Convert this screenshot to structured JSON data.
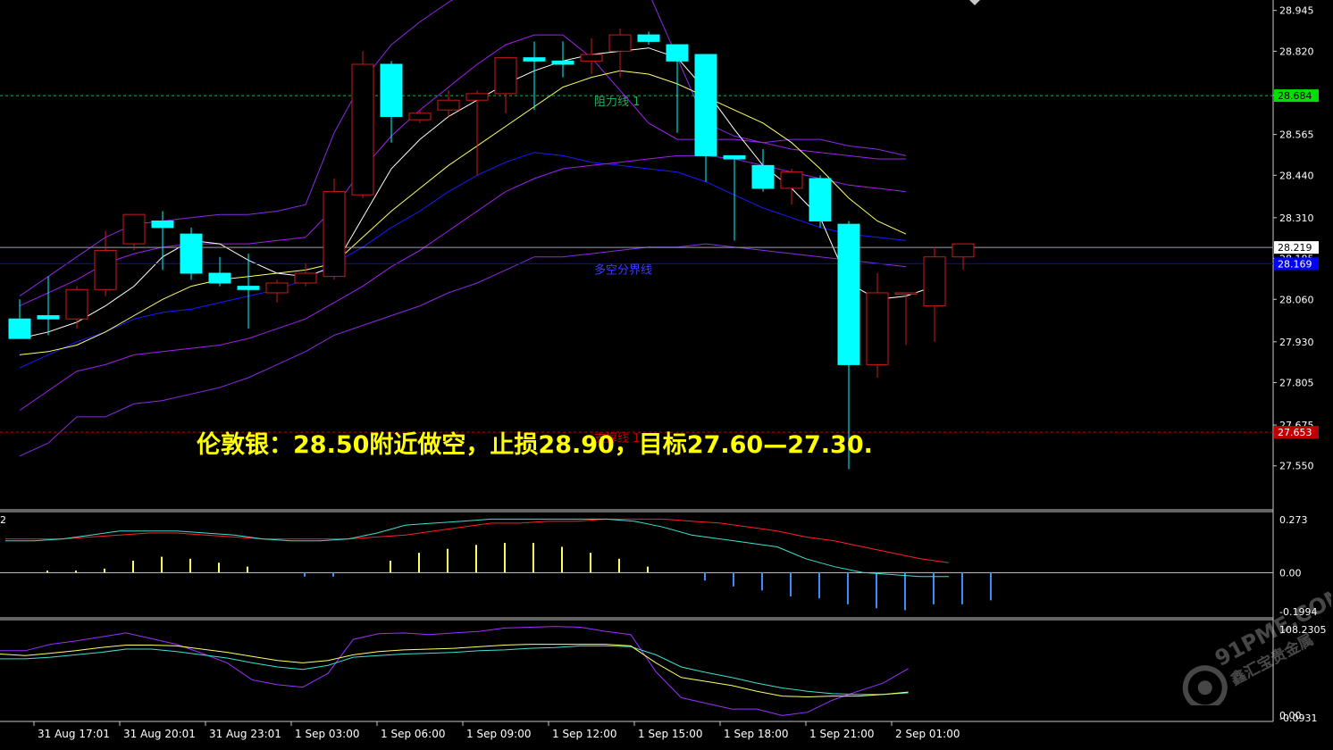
{
  "chart_data": {
    "type": "candlestick",
    "title": "",
    "price_ticks": [
      "28.945",
      "28.820",
      "28.685",
      "28.565",
      "28.440",
      "28.310",
      "28.185",
      "28.060",
      "27.930",
      "27.805",
      "27.675",
      "27.550"
    ],
    "price_range": [
      27.47,
      28.955
    ],
    "time_labels": [
      "31 Aug 17:01",
      "31 Aug 20:01",
      "31 Aug 23:01",
      "1 Sep 03:00",
      "1 Sep 06:00",
      "1 Sep 09:00",
      "1 Sep 12:00",
      "1 Sep 15:00",
      "1 Sep 18:00",
      "1 Sep 21:00",
      "2 Sep 01:00"
    ],
    "time_label_bars": [
      1,
      4,
      7,
      10,
      13,
      16,
      19,
      22,
      25,
      28,
      31
    ],
    "bar_spacing_bars": 32,
    "candles": [
      {
        "o": 28.0,
        "h": 28.06,
        "l": 27.95,
        "c": 27.94
      },
      {
        "o": 28.01,
        "h": 28.13,
        "l": 27.95,
        "c": 28.0
      },
      {
        "o": 28.0,
        "h": 28.1,
        "l": 27.97,
        "c": 28.09
      },
      {
        "o": 28.09,
        "h": 28.27,
        "l": 28.07,
        "c": 28.21
      },
      {
        "o": 28.23,
        "h": 28.32,
        "l": 28.21,
        "c": 28.32
      },
      {
        "o": 28.3,
        "h": 28.33,
        "l": 28.15,
        "c": 28.28
      },
      {
        "o": 28.26,
        "h": 28.28,
        "l": 28.12,
        "c": 28.14
      },
      {
        "o": 28.14,
        "h": 28.19,
        "l": 28.1,
        "c": 28.11
      },
      {
        "o": 28.1,
        "h": 28.2,
        "l": 27.97,
        "c": 28.09
      },
      {
        "o": 28.08,
        "h": 28.12,
        "l": 28.05,
        "c": 28.11
      },
      {
        "o": 28.11,
        "h": 28.17,
        "l": 28.1,
        "c": 28.14
      },
      {
        "o": 28.13,
        "h": 28.43,
        "l": 28.12,
        "c": 28.39
      },
      {
        "o": 28.38,
        "h": 28.82,
        "l": 28.37,
        "c": 28.78
      },
      {
        "o": 28.78,
        "h": 28.79,
        "l": 28.54,
        "c": 28.62
      },
      {
        "o": 28.61,
        "h": 28.64,
        "l": 28.6,
        "c": 28.63
      },
      {
        "o": 28.64,
        "h": 28.7,
        "l": 28.62,
        "c": 28.67
      },
      {
        "o": 28.67,
        "h": 28.7,
        "l": 28.44,
        "c": 28.69
      },
      {
        "o": 28.69,
        "h": 28.77,
        "l": 28.63,
        "c": 28.8
      },
      {
        "o": 28.8,
        "h": 28.85,
        "l": 28.64,
        "c": 28.79
      },
      {
        "o": 28.79,
        "h": 28.85,
        "l": 28.74,
        "c": 28.78
      },
      {
        "o": 28.79,
        "h": 28.86,
        "l": 28.75,
        "c": 28.81
      },
      {
        "o": 28.82,
        "h": 28.89,
        "l": 28.74,
        "c": 28.87
      },
      {
        "o": 28.87,
        "h": 28.88,
        "l": 28.84,
        "c": 28.85
      },
      {
        "o": 28.84,
        "h": 28.83,
        "l": 28.57,
        "c": 28.79
      },
      {
        "o": 28.81,
        "h": 28.8,
        "l": 28.42,
        "c": 28.5
      },
      {
        "o": 28.5,
        "h": 28.5,
        "l": 28.24,
        "c": 28.49
      },
      {
        "o": 28.47,
        "h": 28.52,
        "l": 28.39,
        "c": 28.4
      },
      {
        "o": 28.4,
        "h": 28.46,
        "l": 28.35,
        "c": 28.45
      },
      {
        "o": 28.43,
        "h": 28.44,
        "l": 28.28,
        "c": 28.3
      },
      {
        "o": 28.29,
        "h": 28.3,
        "l": 27.54,
        "c": 27.86
      },
      {
        "o": 27.86,
        "h": 28.14,
        "l": 27.82,
        "c": 28.08
      },
      {
        "o": 28.08,
        "h": 28.08,
        "l": 27.92,
        "c": 28.08
      },
      {
        "o": 28.04,
        "h": 28.22,
        "l": 27.93,
        "c": 28.19
      },
      {
        "o": 28.19,
        "h": 28.23,
        "l": 28.15,
        "c": 28.23
      }
    ],
    "ma_fast": [
      27.94,
      27.96,
      27.99,
      28.04,
      28.1,
      28.19,
      28.24,
      28.23,
      28.18,
      28.14,
      28.13,
      28.16,
      28.31,
      28.46,
      28.55,
      28.62,
      28.67,
      28.72,
      28.76,
      28.79,
      28.81,
      28.82,
      28.83,
      28.8,
      28.7,
      28.58,
      28.47,
      28.4,
      28.31,
      28.11,
      28.06,
      28.07,
      28.1
    ],
    "ma_slow": [
      27.89,
      27.9,
      27.92,
      27.96,
      28.01,
      28.06,
      28.1,
      28.12,
      28.13,
      28.14,
      28.15,
      28.17,
      28.25,
      28.33,
      28.4,
      28.47,
      28.53,
      28.59,
      28.65,
      28.71,
      28.74,
      28.76,
      28.75,
      28.72,
      28.68,
      28.64,
      28.6,
      28.54,
      28.46,
      28.37,
      28.3,
      28.26
    ],
    "bb_upper": [
      28.07,
      28.13,
      28.19,
      28.25,
      28.29,
      28.3,
      28.31,
      28.32,
      28.32,
      28.33,
      28.35,
      28.57,
      28.73,
      28.84,
      28.91,
      28.97,
      29.02,
      29.07,
      29.1,
      29.13,
      29.15,
      29.1,
      29.0,
      28.8,
      28.6,
      28.56,
      28.54,
      28.55,
      28.55,
      28.53,
      28.52,
      28.5
    ],
    "bb_middle": [
      27.85,
      27.89,
      27.93,
      27.96,
      28.0,
      28.02,
      28.03,
      28.05,
      28.07,
      28.09,
      28.12,
      28.17,
      28.22,
      28.28,
      28.33,
      28.39,
      28.44,
      28.48,
      28.51,
      28.5,
      28.48,
      28.47,
      28.46,
      28.45,
      28.42,
      28.38,
      28.34,
      28.31,
      28.28,
      28.26,
      28.25,
      28.24
    ],
    "bb_lower": [
      27.58,
      27.62,
      27.7,
      27.7,
      27.74,
      27.75,
      27.77,
      27.79,
      27.82,
      27.86,
      27.9,
      27.95,
      27.98,
      28.01,
      28.04,
      28.08,
      28.11,
      28.15,
      28.19,
      28.19,
      28.2,
      28.21,
      28.22,
      28.22,
      28.23,
      28.22,
      28.21,
      28.2,
      28.19,
      28.18,
      28.17,
      28.16
    ],
    "env_upper": [
      28.04,
      28.08,
      28.12,
      28.17,
      28.2,
      28.22,
      28.23,
      28.23,
      28.23,
      28.24,
      28.25,
      28.34,
      28.46,
      28.56,
      28.64,
      28.71,
      28.78,
      28.84,
      28.87,
      28.87,
      28.8,
      28.7,
      28.6,
      28.55,
      28.55,
      28.55,
      28.54,
      28.52,
      28.51,
      28.5,
      28.49,
      28.49
    ],
    "env_lower": [
      27.72,
      27.78,
      27.84,
      27.86,
      27.89,
      27.9,
      27.91,
      27.92,
      27.94,
      27.97,
      28.0,
      28.05,
      28.1,
      28.16,
      28.21,
      28.27,
      28.33,
      28.39,
      28.43,
      28.46,
      28.47,
      28.48,
      28.49,
      28.5,
      28.5,
      28.49,
      28.47,
      28.45,
      28.43,
      28.41,
      28.4,
      28.39
    ],
    "hlines": [
      {
        "label": "阻力线 1",
        "value": 28.684,
        "value_text": "28.684",
        "color": "#19b05a",
        "tag_bg": "#00e000",
        "tag_fg": "#000000",
        "style": "dashed"
      },
      {
        "label": "多空分界线",
        "value": 28.169,
        "value_text": "28.169",
        "color": "#0000ff",
        "tag_bg": "#0000ff",
        "tag_fg": "#ffffff",
        "style": "solid"
      },
      {
        "label": "支撑线 1",
        "value": 27.653,
        "value_text": "27.653",
        "color": "#c00000",
        "tag_bg": "#c00000",
        "tag_fg": "#ffffff",
        "style": "dashed"
      }
    ],
    "current_price": {
      "value": 28.219,
      "value_text": "28.219"
    },
    "macd": {
      "ticks": [
        "0.273",
        "0.00",
        "-0.1994"
      ],
      "range": [
        -0.215,
        0.29
      ],
      "label": "2",
      "histogram": [
        0.0,
        0.01,
        0.01,
        0.02,
        0.06,
        0.08,
        0.07,
        0.05,
        0.03,
        0.0,
        -0.02,
        -0.02,
        0.0,
        0.06,
        0.1,
        0.12,
        0.14,
        0.15,
        0.15,
        0.13,
        0.1,
        0.07,
        0.03,
        0.0,
        -0.04,
        -0.07,
        -0.09,
        -0.12,
        -0.13,
        -0.16,
        -0.18,
        -0.19,
        -0.16,
        -0.16,
        -0.14
      ],
      "signal": [
        0.17,
        0.17,
        0.17,
        0.18,
        0.19,
        0.2,
        0.2,
        0.19,
        0.18,
        0.17,
        0.17,
        0.17,
        0.17,
        0.18,
        0.19,
        0.21,
        0.23,
        0.25,
        0.25,
        0.26,
        0.26,
        0.27,
        0.27,
        0.27,
        0.26,
        0.25,
        0.23,
        0.21,
        0.18,
        0.16,
        0.13,
        0.1,
        0.07,
        0.05
      ],
      "macd": [
        0.16,
        0.16,
        0.17,
        0.19,
        0.21,
        0.21,
        0.21,
        0.2,
        0.19,
        0.17,
        0.16,
        0.16,
        0.17,
        0.2,
        0.24,
        0.25,
        0.26,
        0.27,
        0.27,
        0.27,
        0.27,
        0.27,
        0.26,
        0.23,
        0.19,
        0.17,
        0.15,
        0.13,
        0.07,
        0.03,
        0.0,
        -0.01,
        -0.02,
        -0.02
      ]
    },
    "kdj": {
      "ticks": [
        "108.2305",
        "0.00",
        "-0.0931"
      ],
      "range": [
        -6,
        112
      ],
      "k": [
        74,
        72,
        75,
        78,
        82,
        85,
        85,
        84,
        80,
        76,
        71,
        66,
        63,
        66,
        73,
        77,
        79,
        80,
        81,
        83,
        85,
        86,
        86,
        86,
        86,
        84,
        63,
        45,
        40,
        35,
        28,
        22,
        21,
        22,
        22,
        24,
        27
      ],
      "d": [
        68,
        68,
        70,
        73,
        76,
        80,
        80,
        77,
        73,
        69,
        63,
        58,
        55,
        60,
        70,
        72,
        74,
        75,
        76,
        78,
        79,
        81,
        82,
        84,
        84,
        83,
        73,
        58,
        51,
        45,
        38,
        32,
        28,
        25,
        24,
        24,
        26
      ],
      "j": [
        78,
        78,
        86,
        90,
        95,
        100,
        93,
        86,
        75,
        63,
        42,
        36,
        33,
        50,
        92,
        99,
        100,
        98,
        100,
        102,
        106,
        107,
        108,
        107,
        102,
        98,
        52,
        20,
        13,
        6,
        6,
        -2,
        2,
        17,
        28,
        38,
        56
      ]
    }
  },
  "headline": "伦敦银：28.50附近做空，止损28.90，目标27.60—27.30.",
  "watermark": {
    "brand": "91PME.COM",
    "cn": "鑫汇宝贵金属"
  }
}
